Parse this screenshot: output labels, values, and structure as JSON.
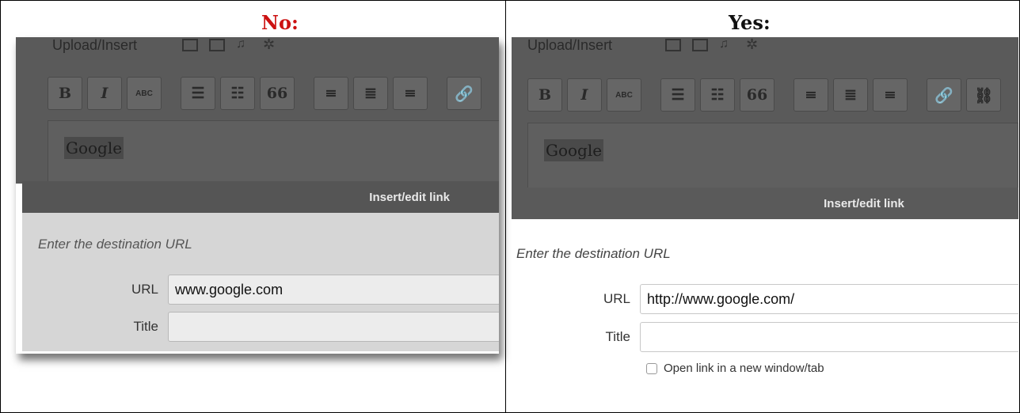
{
  "comparison": {
    "no_heading": "No:",
    "yes_heading": "Yes:"
  },
  "left_example": {
    "upload_label": "Upload/Insert",
    "selected_text": "Google",
    "dialog_title": "Insert/edit link",
    "hint": "Enter the destination URL",
    "url_label": "URL",
    "url_value": "www.google.com",
    "title_label": "Title",
    "title_value": ""
  },
  "right_example": {
    "upload_label": "Upload/Insert",
    "selected_text": "Google",
    "dialog_title": "Insert/edit link",
    "hint": "Enter the destination URL",
    "url_label": "URL",
    "url_value": "http://www.google.com/",
    "title_label": "Title",
    "title_value": "",
    "new_window_label": "Open link in a new window/tab"
  },
  "toolbar": {
    "bold": "B",
    "italic": "I",
    "strike": "ABC",
    "blockquote": "66"
  },
  "colors": {
    "no_heading": "#cc1111",
    "yes_heading": "#111111",
    "dialog_titlebar": "#555555"
  }
}
